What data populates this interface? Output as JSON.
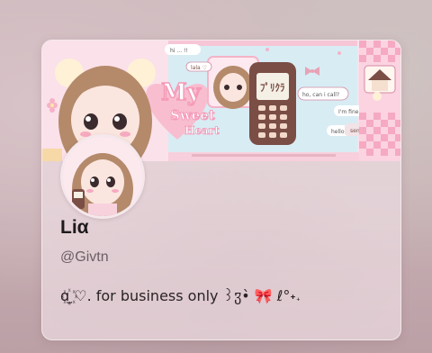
{
  "profile": {
    "display_name": "Liα",
    "handle": "@Givtn",
    "bio": "ɑ꙰̫ ♡. for business only ꒱ჳ•̀ 🎀 ℓ°˖𝅄"
  },
  "banner": {
    "title_line1": "My",
    "title_line2": "Sweet",
    "title_line3": "Heart",
    "phone_screen_text": "ﾌﾟﾘｸﾗ",
    "bubble_hi": "hi ... !!",
    "bubble_lala": "lala ♡",
    "bubble_call": "ho, can i call?",
    "bubble_fine": "I'm fine !!",
    "bubble_hello": "hello!",
    "send_label": "send ✈"
  },
  "colors": {
    "banner_pink": "#f7c6d6",
    "banner_blue": "#cfe8f3",
    "phone_brown": "#7a4e45",
    "checker_pink": "#f5a9c2",
    "title_pink": "#f59ab8"
  },
  "icons": [
    "avatar-image",
    "banner-image",
    "bow-icon"
  ]
}
